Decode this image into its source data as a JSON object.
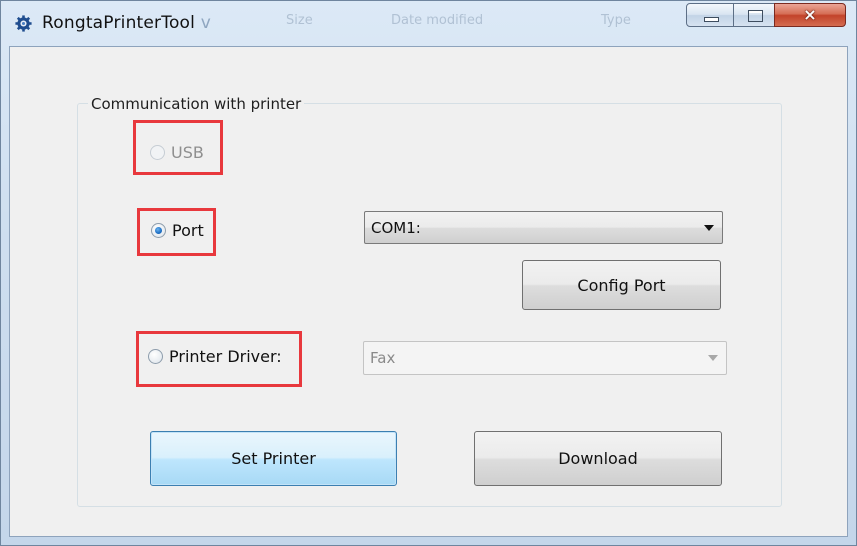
{
  "window": {
    "title": "RongtaPrinterTool",
    "title_suffix_ghost": "v",
    "background_ghost": [
      "Size",
      "Date modified",
      "Type"
    ],
    "icon": "gear-icon",
    "controls": {
      "minimize": "minimize-icon",
      "maximize": "maximize-icon",
      "close": "×"
    }
  },
  "group": {
    "title": "Communication with printer"
  },
  "options": {
    "usb": {
      "label": "USB",
      "checked": false,
      "enabled": false
    },
    "port": {
      "label": "Port",
      "checked": true,
      "enabled": true
    },
    "printer_driver": {
      "label": "Printer Driver:",
      "checked": false,
      "enabled": true
    }
  },
  "port_select": {
    "value": "COM1:",
    "enabled": true
  },
  "driver_select": {
    "value": "Fax",
    "enabled": false
  },
  "buttons": {
    "config_port": "Config Port",
    "set_printer": "Set Printer",
    "download": "Download"
  },
  "colors": {
    "highlight": "#e8383d",
    "radio_selected": "#1d6fc4",
    "default_button_border": "#3c7fb1"
  }
}
